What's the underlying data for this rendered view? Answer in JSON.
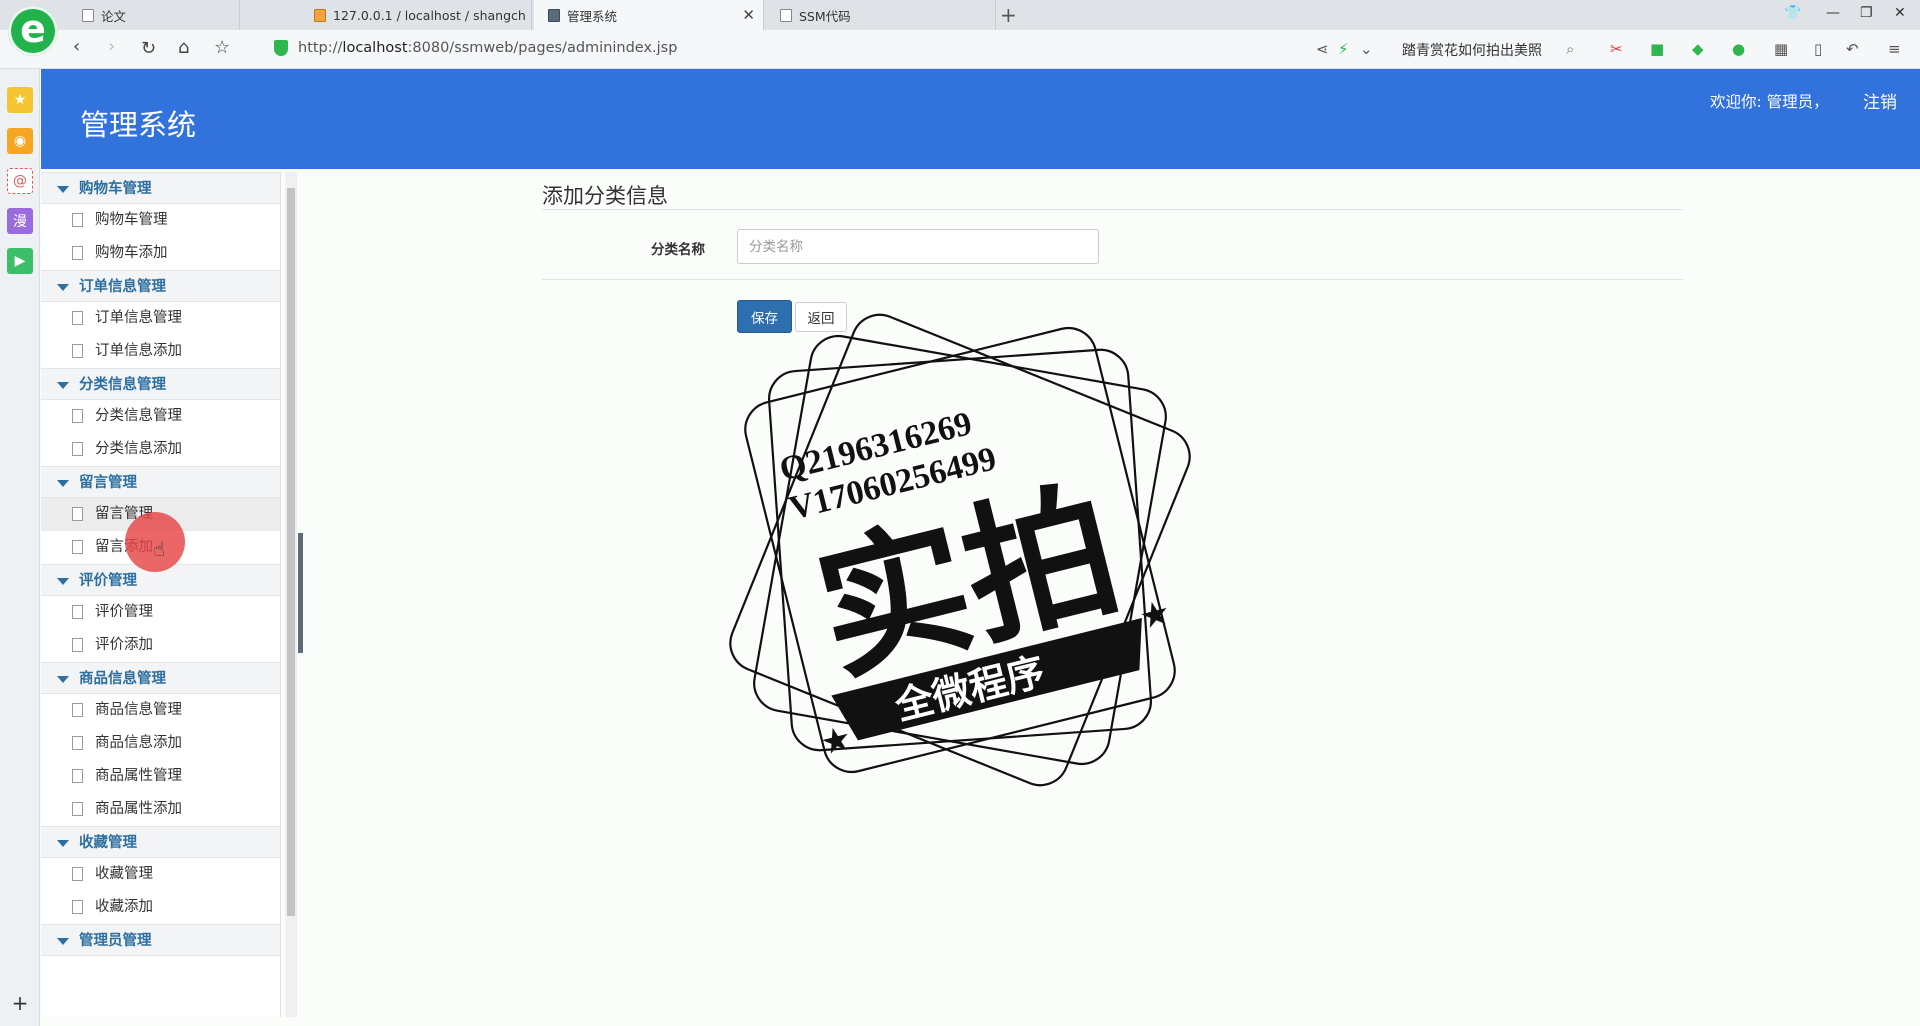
{
  "browser": {
    "tabs": [
      {
        "title": "论文"
      },
      {
        "title": "127.0.0.1 / localhost / shangch"
      },
      {
        "title": "管理系统"
      },
      {
        "title": "SSM代码"
      }
    ],
    "url_prefix": "http://",
    "url_host": "localhost",
    "url_rest": ":8080/ssmweb/pages/adminindex.jsp",
    "search_text": "踏青赏花如何拍出美照"
  },
  "app": {
    "title": "管理系统",
    "welcome": "欢迎你: 管理员，",
    "logout": "注销"
  },
  "menu": [
    {
      "group": "购物车管理",
      "items": [
        "购物车管理",
        "购物车添加"
      ]
    },
    {
      "group": "订单信息管理",
      "items": [
        "订单信息管理",
        "订单信息添加"
      ]
    },
    {
      "group": "分类信息管理",
      "items": [
        "分类信息管理",
        "分类信息添加"
      ]
    },
    {
      "group": "留言管理",
      "items": [
        "留言管理",
        "留言添加"
      ]
    },
    {
      "group": "评价管理",
      "items": [
        "评价管理",
        "评价添加"
      ]
    },
    {
      "group": "商品信息管理",
      "items": [
        "商品信息管理",
        "商品信息添加",
        "商品属性管理",
        "商品属性添加"
      ]
    },
    {
      "group": "收藏管理",
      "items": [
        "收藏管理",
        "收藏添加"
      ]
    },
    {
      "group": "管理员管理",
      "items": []
    }
  ],
  "form": {
    "title": "添加分类信息",
    "field_label": "分类名称",
    "field_placeholder": "分类名称",
    "save": "保存",
    "back": "返回"
  },
  "watermark": {
    "line1": "Q2196316269",
    "line2": "V17060256499",
    "big": "实拍",
    "banner": "全微程序"
  },
  "colors": {
    "header": "#3272dc",
    "menu_group_text": "#2e6fa0",
    "save_button": "#2e6fb0"
  }
}
